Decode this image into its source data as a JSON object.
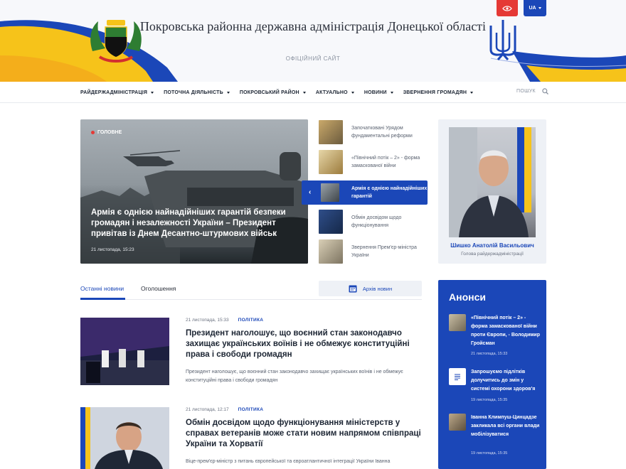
{
  "header": {
    "title": "Покровська районна державна адміністрація Донецької області",
    "subtitle": "ОФІЦІЙНИЙ САЙТ",
    "lang": "UA",
    "brand_blue": "#1b47b8",
    "brand_yellow": "#f6c31a",
    "accent_red": "#e53935"
  },
  "nav": {
    "items": [
      {
        "label": "РАЙДЕРЖАДМІНІСТРАЦІЯ"
      },
      {
        "label": "ПОТОЧНА ДІЯЛЬНІСТЬ"
      },
      {
        "label": "ПОКРОВСЬКИЙ РАЙОН"
      },
      {
        "label": "АКТУАЛЬНО"
      },
      {
        "label": "НОВИНИ"
      },
      {
        "label": "ЗВЕРНЕННЯ ГРОМАДЯН"
      }
    ],
    "search_label": "ПОШУК"
  },
  "hero": {
    "tag": "ГОЛОВНЕ",
    "title": "Армія є однією найнадійніших гарантій безпеки громадян і незалежності України – Президент привітав із Днем Десантно-штурмових військ",
    "date": "21 листопада, 15:23"
  },
  "side_news": [
    {
      "text": "Започатковані Урядом фундаментальні реформи"
    },
    {
      "text": "«Північний потік – 2» - форма замаскованої війни"
    },
    {
      "text": "Армія є однією найнадійніших гарантій",
      "active": true
    },
    {
      "text": "Обмін досвідом щодо функціонування"
    },
    {
      "text": "Звернення Прем'єр-міністра України"
    }
  ],
  "person": {
    "name": "Шишко Анатолій Васильович",
    "role": "Голова райдержадміністрації"
  },
  "tabs": {
    "items": [
      {
        "label": "Останні новини",
        "active": true
      },
      {
        "label": "Оголошення",
        "active": false
      }
    ],
    "archive_label": "Архів новин"
  },
  "news": [
    {
      "date": "21 листопада, 15:33",
      "category": "ПОЛІТИКА",
      "title": "Президент наголошує, що воєнний стан законодавчо захищає українських воїнів і не обмежує конституційні права і свободи громадян",
      "excerpt": "Президент наголошує, що воєнний стан законодавчо захищає українських воїнів і не обмежує конституційні права і свободи громадян"
    },
    {
      "date": "21 листопада, 12:17",
      "category": "ПОЛІТИКА",
      "title": "Обмін досвідом щодо функціонування міністерств у справах ветеранів може стати новим напрямом співпраці України та Хорватії",
      "excerpt": "Віце-прем'єр-міністр з питань європейської та євроатлантичної інтеграції України Іванна"
    }
  ],
  "announcements": {
    "title": "Анонси",
    "items": [
      {
        "icon": "building-photo-icon",
        "text": "«Північний потік – 2» - форма замаскованої війни проти Європи, - Володимир Гройсман",
        "date": "21 листопада, 15:33"
      },
      {
        "icon": "document-icon",
        "text": "Запрошуємо підлітків долучитись до змін у системі охорони здоров'я",
        "date": "19 листопада, 15:35"
      },
      {
        "icon": "building-photo-icon",
        "text": "Іванна Климпуш-Цинцадзе закликала всі органи влади мобілізуватися",
        "date": "19 листопада, 15:35"
      }
    ]
  }
}
